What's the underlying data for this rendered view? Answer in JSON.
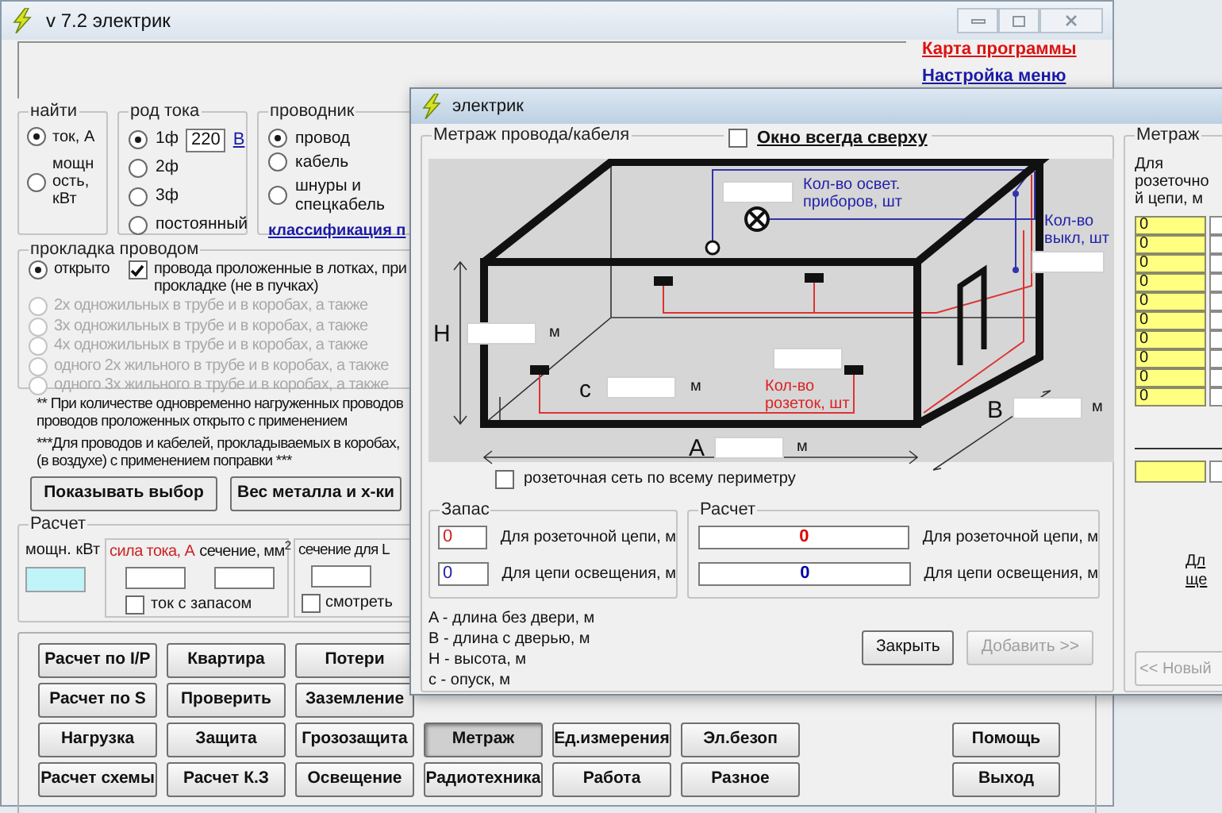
{
  "main_window": {
    "title": "v 7.2 электрик",
    "links": [
      {
        "text": "Карта программы",
        "color": "#dd1111"
      },
      {
        "text": "Настройка меню",
        "color": "#1a1aa8"
      }
    ],
    "find": {
      "title": "найти",
      "options": [
        {
          "label": "ток, А",
          "selected": true
        },
        {
          "label": "мощность, кВт",
          "selected": false
        }
      ]
    },
    "current_type": {
      "title": "род тока",
      "voltage": "220",
      "voltage_unit": "В",
      "options": [
        {
          "label": "1ф",
          "selected": true
        },
        {
          "label": "2ф",
          "selected": false
        },
        {
          "label": "3ф",
          "selected": false
        },
        {
          "label": "постоянный",
          "selected": false
        }
      ]
    },
    "conductor": {
      "title": "проводник",
      "link": "классификация п",
      "options": [
        {
          "label": "провод",
          "selected": true
        },
        {
          "label": "кабель",
          "selected": false
        },
        {
          "label": "шнуры и спецкабель",
          "selected": false
        }
      ]
    },
    "laying": {
      "title": "прокладка проводом",
      "tray_check": {
        "lines": [
          "провода проложенные в лотках, при",
          "прокладке (не в пучках)"
        ],
        "checked": true
      },
      "options": [
        {
          "label": "открыто",
          "selected": true,
          "disabled": false
        },
        {
          "label": "2х одножильных в трубе и в коробах, а также",
          "selected": false,
          "disabled": true
        },
        {
          "label": "3х одножильных в трубе и в коробах, а также",
          "selected": false,
          "disabled": true
        },
        {
          "label": "4х одножильных в трубе и в коробах, а также",
          "selected": false,
          "disabled": true
        },
        {
          "label": "одного 2х жильного в трубе и в коробах, а также",
          "selected": false,
          "disabled": true
        },
        {
          "label": "одного 3х жильного в трубе и в коробах, а также",
          "selected": false,
          "disabled": true
        }
      ]
    },
    "notes": [
      {
        "lines": [
          "** При количестве одновременно нагруженных проводов",
          "проводов проложенных открыто с применением"
        ]
      },
      {
        "lines": [
          "***Для проводов и кабелей, прокладываемых в коробах,",
          "(в воздухе) с применением поправки ***"
        ]
      }
    ],
    "actions": [
      "Показывать выбор",
      "Вес металла и х-ки"
    ],
    "calc": {
      "title": "Расчет",
      "power_label": "мощн. кВт",
      "current_label": "сила тока, А",
      "section_label": "сечение, мм$^{2}$",
      "reserve_check": {
        "label": "ток с запасом",
        "checked": false
      },
      "section_l_label": "сечение для L",
      "view_check": {
        "label": "смотреть",
        "checked": false
      }
    },
    "buttons": [
      [
        {
          "label": "Расчет по I/P",
          "pressed": false
        },
        {
          "label": "Квартира",
          "pressed": false
        },
        {
          "label": "Потери",
          "pressed": false
        }
      ],
      [
        {
          "label": "Расчет по S",
          "pressed": false
        },
        {
          "label": "Проверить",
          "pressed": false
        },
        {
          "label": "Заземление",
          "pressed": false
        }
      ],
      [
        {
          "label": "Нагрузка",
          "pressed": false
        },
        {
          "label": "Защита",
          "pressed": false
        },
        {
          "label": "Грозозащита",
          "pressed": false
        },
        {
          "label": "Метраж",
          "pressed": true
        },
        {
          "label": "Ед.измерения",
          "pressed": false
        },
        {
          "label": "Эл.безоп",
          "pressed": false
        }
      ],
      [
        {
          "label": "Расчет схемы",
          "pressed": false
        },
        {
          "label": "Расчет К.З",
          "pressed": false
        },
        {
          "label": "Освещение",
          "pressed": false
        },
        {
          "label": "Радиотехника",
          "pressed": false
        },
        {
          "label": "Работа",
          "pressed": false
        },
        {
          "label": "Разное",
          "pressed": false
        }
      ]
    ],
    "side_buttons": [
      "Помощь",
      "Выход"
    ]
  },
  "dialog": {
    "title": "электрик",
    "group_title": "Метраж провода/кабеля",
    "always_on_top": {
      "label": "Окно всегда сверху",
      "checked": false
    },
    "diagram": {
      "lights_label": "Кол-во освет. приборов, шт",
      "switches_label": "Кол-во выкл, шт",
      "sockets_label": "Кол-во розеток, шт",
      "dims": [
        {
          "letter": "H",
          "unit": "м"
        },
        {
          "letter": "с",
          "unit": "м"
        },
        {
          "letter": "B",
          "unit": "м"
        },
        {
          "letter": "A",
          "unit": "м"
        }
      ]
    },
    "perimeter": {
      "label": "розеточная сеть по всему периметру",
      "checked": false
    },
    "reserve": {
      "title": "Запас",
      "rows": [
        {
          "value": "0",
          "label": "Для розеточной цепи, м",
          "color": "#cc2222"
        },
        {
          "value": "0",
          "label": "Для цепи освещения, м",
          "color": "#2222aa"
        }
      ]
    },
    "result": {
      "title": "Расчет",
      "rows": [
        {
          "value": "0",
          "label": "Для розеточной цепи, м",
          "color": "#dd0000"
        },
        {
          "value": "0",
          "label": "Для цепи освещения, м",
          "color": "#0000aa"
        }
      ]
    },
    "legend": [
      "A - длина без двери, м",
      "B - длина с дверью, м",
      "H - высота, м",
      "с - опуск, м"
    ],
    "buttons": [
      {
        "label": "Закрыть",
        "disabled": false
      },
      {
        "label": "Добавить >>",
        "disabled": true
      }
    ],
    "meter": {
      "title": "Метраж",
      "header": "Для розеточной цепи, м",
      "values": [
        "0",
        "0",
        "0",
        "0",
        "0",
        "0",
        "0",
        "0",
        "0",
        "0"
      ],
      "link_lines": [
        "Дл",
        "ще"
      ],
      "new_button": "<< Новый"
    }
  }
}
